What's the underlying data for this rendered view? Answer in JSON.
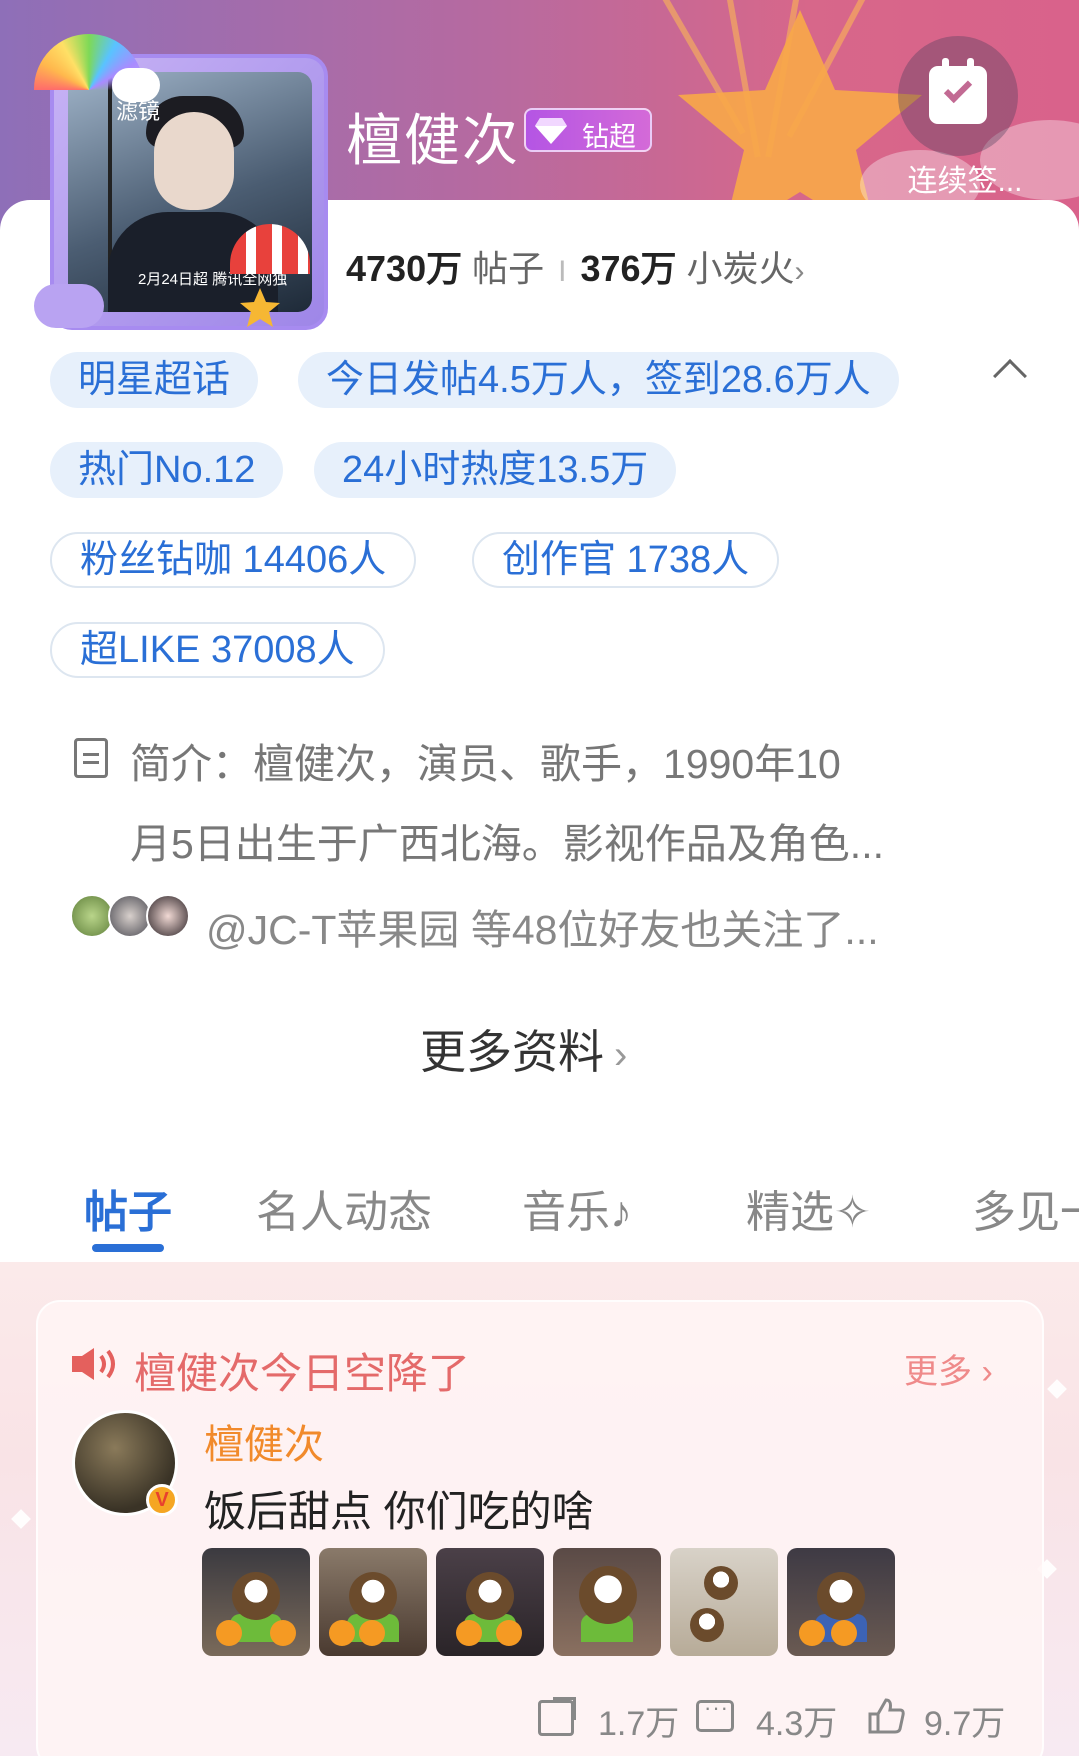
{
  "header": {
    "name": "檀健次",
    "badge_label": "钻超",
    "checkin_label": "连续签...",
    "avatar_title": "滤镜",
    "avatar_caption": "2月24日超 腾讯全网独"
  },
  "stats": {
    "posts_value": "4730万",
    "posts_label": "帖子",
    "separator": "I",
    "fire_value": "376万",
    "fire_label": "小炭火",
    "chevron": "›"
  },
  "chips": [
    "明星超话",
    "今日发帖4.5万人，签到28.6万人",
    "热门No.12",
    "24小时热度13.5万",
    "粉丝钻咖 14406人",
    "创作官 1738人",
    "超LIKE 37008人"
  ],
  "intro": {
    "line1": "简介：檀健次，演员、歌手，1990年10",
    "line2": "月5日出生于广西北海。影视作品及角色..."
  },
  "friends_text": "@JC-T苹果园 等48位好友也关注了...",
  "more_info": {
    "label": "更多资料",
    "chevron": "›"
  },
  "tabs": [
    "帖子",
    "名人动态",
    "音乐",
    "精选",
    "多见一"
  ],
  "tab_glyphs": {
    "music": "♪",
    "featured": "✧"
  },
  "drop": {
    "title": "檀健次今日空降了",
    "more_label": "更多 ›",
    "poster_name": "檀健次",
    "verified_mark": "V",
    "post_text": "饭后甜点 你们吃的啥",
    "shares": "1.7万",
    "comments": "4.3万",
    "likes": "9.7万"
  },
  "colors": {
    "accent_blue": "#2a6fd6",
    "drop_red": "#e46a6a",
    "poster_orange": "#f18a2b",
    "badge_purple": "#b455e4"
  }
}
